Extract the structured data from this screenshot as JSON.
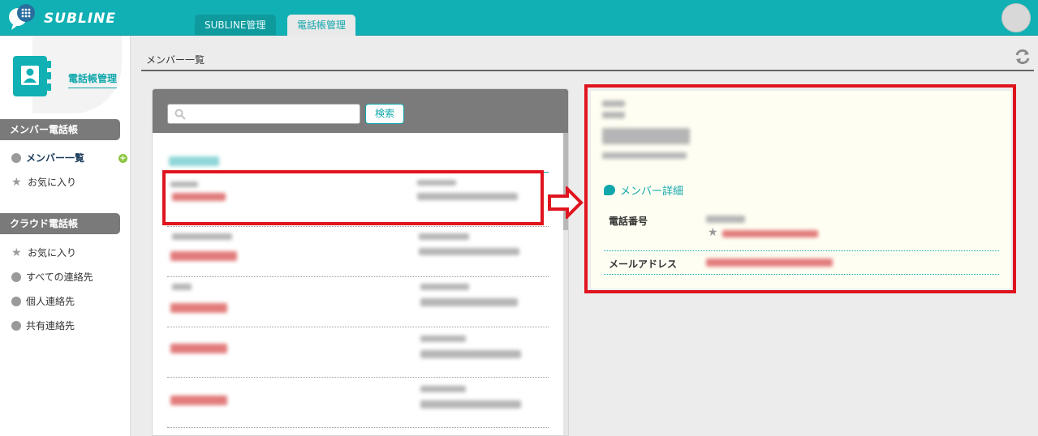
{
  "header": {
    "logo_text": "SUBLINE",
    "tabs": [
      {
        "label": "SUBLINE管理"
      },
      {
        "label": "電話帳管理"
      }
    ]
  },
  "sidebar": {
    "title": "電話帳管理",
    "sections": [
      {
        "heading": "メンバー電話帳",
        "items": [
          {
            "label": "メンバー一覧",
            "icon": "dot-icon"
          },
          {
            "label": "お気に入り",
            "icon": "star-icon"
          }
        ]
      },
      {
        "heading": "クラウド電話帳",
        "items": [
          {
            "label": "お気に入り",
            "icon": "star-icon"
          },
          {
            "label": "すべての連絡先",
            "icon": "dot-icon"
          },
          {
            "label": "個人連絡先",
            "icon": "dot-icon"
          },
          {
            "label": "共有連絡先",
            "icon": "dot-icon"
          }
        ]
      }
    ]
  },
  "main": {
    "page_title": "メンバー一覧",
    "search": {
      "placeholder": "",
      "button_label": "検索"
    }
  },
  "detail": {
    "caption": "メンバー詳細",
    "fields": [
      {
        "label": "電話番号"
      },
      {
        "label": "メールアドレス"
      }
    ]
  },
  "colors": {
    "accent": "#10b0b4",
    "highlight": "#e0141e",
    "section_heading": "#7a7a7a"
  }
}
